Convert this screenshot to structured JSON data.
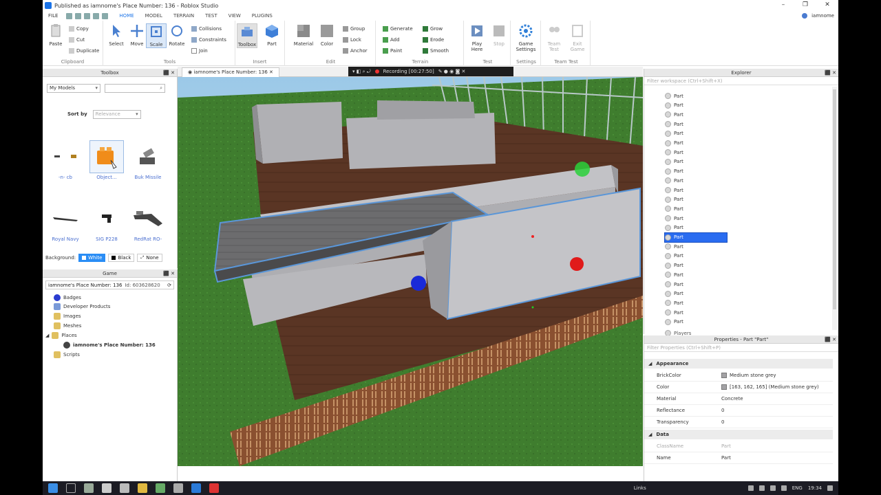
{
  "window": {
    "title": "Published as iamnome's Place Number: 136 - Roblox Studio",
    "min": "–",
    "max": "❐",
    "close": "✕"
  },
  "ribbon_tabs": [
    "FILE",
    "HOME",
    "MODEL",
    "TERRAIN",
    "TEST",
    "VIEW",
    "PLUGINS"
  ],
  "active_tab": "HOME",
  "user": "iamnome",
  "ribbon": {
    "clipboard": {
      "label": "Clipboard",
      "paste": "Paste",
      "copy": "Copy",
      "cut": "Cut",
      "duplicate": "Duplicate"
    },
    "tools": {
      "label": "Tools",
      "select": "Select",
      "move": "Move",
      "scale": "Scale",
      "rotate": "Rotate",
      "collisions": "Collisions",
      "constraints": "Constraints",
      "join": "Join"
    },
    "insert": {
      "label": "Insert",
      "toolbox": "Toolbox",
      "part": "Part"
    },
    "edit": {
      "label": "Edit",
      "material": "Material",
      "color": "Color",
      "group": "Group",
      "lock": "Lock",
      "anchor": "Anchor"
    },
    "terrain": {
      "label": "Terrain",
      "generate": "Generate",
      "add": "Add",
      "paint": "Paint",
      "grow": "Grow",
      "erode": "Erode",
      "smooth": "Smooth"
    },
    "test": {
      "label": "Test",
      "play_here": "Play Here",
      "stop": "Stop"
    },
    "settings": {
      "label": "Settings",
      "game_settings": "Game Settings"
    },
    "team_test": {
      "label": "Team Test",
      "team_test": "Team Test",
      "exit_game": "Exit Game"
    }
  },
  "toolbox": {
    "title": "Toolbox",
    "category": "My Models",
    "search_placeholder": "",
    "sort_label": "Sort by",
    "sort_value": "Relevance",
    "models": [
      {
        "name": "-n- cb"
      },
      {
        "name": "Object..."
      },
      {
        "name": "Buk Missile"
      },
      {
        "name": "Royal Navy"
      },
      {
        "name": "SIG P228"
      },
      {
        "name": "RedRat RO-"
      }
    ],
    "background_label": "Background:",
    "bg_options": [
      "White",
      "Black",
      "None"
    ]
  },
  "game": {
    "title": "Game",
    "place_name": "iamnome's Place Number: 136",
    "place_id": "Id: 603628620",
    "items": [
      "Badges",
      "Developer Products",
      "Images",
      "Meshes",
      "Places",
      "iamnome's Place Number: 136",
      "Scripts"
    ]
  },
  "viewport": {
    "doc_tab": "iamnome's Place Number: 136",
    "recording": "Recording [00:27:50]"
  },
  "explorer": {
    "title": "Explorer",
    "filter_placeholder": "Filter workspace (Ctrl+Shift+X)",
    "part_label": "Part",
    "row_count": 25,
    "selected_index": 15,
    "last_item": "Players"
  },
  "properties": {
    "title": "Properties - Part \"Part\"",
    "filter_placeholder": "Filter Properties (Ctrl+Shift+P)",
    "sections": [
      {
        "name": "Appearance",
        "rows": [
          {
            "name": "BrickColor",
            "value": "Medium stone grey",
            "swatch": "#a3a2a5"
          },
          {
            "name": "Color",
            "value": "[163, 162, 165] (Medium stone grey)",
            "swatch": "#a3a2a5"
          },
          {
            "name": "Material",
            "value": "Concrete"
          },
          {
            "name": "Reflectance",
            "value": "0"
          },
          {
            "name": "Transparency",
            "value": "0"
          }
        ]
      },
      {
        "name": "Data",
        "rows": [
          {
            "name": "ClassName",
            "value": "Part",
            "disabled": true
          },
          {
            "name": "Name",
            "value": "Part"
          }
        ]
      }
    ]
  },
  "taskbar": {
    "links": "Links",
    "lang": "ENG",
    "time": "19:34"
  },
  "colors": {
    "accent": "#1a73e8",
    "selection": "#2a6cf0",
    "grass": "#3f7d2e",
    "wood": "#5a3524",
    "wall": "#a9a9ad"
  }
}
